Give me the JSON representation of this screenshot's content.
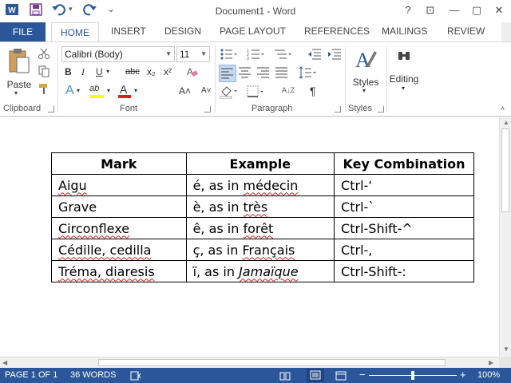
{
  "window": {
    "title": "Document1 - Word",
    "help_glyph": "?",
    "ribbon_display_glyph": "⊡",
    "minimize_glyph": "—",
    "restore_glyph": "▢",
    "close_glyph": "✕"
  },
  "quick_access": {
    "app_icon": "word-icon",
    "save_icon": "save-icon",
    "undo_icon": "undo-icon",
    "redo_icon": "redo-icon",
    "customize_glyph": "⌄"
  },
  "tabs": {
    "file": "FILE",
    "items": [
      "HOME",
      "INSERT",
      "DESIGN",
      "PAGE LAYOUT",
      "REFERENCES",
      "MAILINGS",
      "REVIEW"
    ]
  },
  "ribbon": {
    "groups": {
      "clipboard": "Clipboard",
      "font": "Font",
      "paragraph": "Paragraph",
      "styles": "Styles"
    },
    "paste_label": "Paste",
    "font_name": "Calibri (Body)",
    "font_size": "11",
    "styles_label": "Styles",
    "editing_label": "Editing",
    "font_buttons": {
      "bold": "B",
      "italic": "I",
      "underline": "U",
      "strikethrough": "abc",
      "subscript": "x₂",
      "superscript": "x²",
      "text_effects": "A",
      "highlight": "ab",
      "font_color": "A",
      "grow": "A˄",
      "shrink": "A˅",
      "change_case": "Aa"
    },
    "paragraph_buttons": {
      "show_marks": "¶",
      "sort": "A↓Z"
    }
  },
  "document": {
    "table": {
      "headers": [
        "Mark",
        "Example",
        "Key Combination"
      ],
      "rows": [
        {
          "mark": "Aigu",
          "example_char": "é, as in ",
          "example_word": "médecin",
          "keys": "Ctrl-‘"
        },
        {
          "mark": "Grave",
          "example_char": "è, as in ",
          "example_word": "très",
          "keys": "Ctrl-`"
        },
        {
          "mark": "Circonflexe",
          "example_char": "ê, as in ",
          "example_word": "forêt",
          "keys": "Ctrl-Shift-^"
        },
        {
          "mark": "Cédille, cedilla",
          "example_char": "ç, as in ",
          "example_word": "Français",
          "keys": "Ctrl-,"
        },
        {
          "mark": "Tréma, diaresis",
          "example_char": "ï, as in ",
          "example_word": "Jamaïque",
          "keys": "Ctrl-Shift-:"
        }
      ]
    }
  },
  "status": {
    "page": "PAGE 1 OF 1",
    "words": "36 WORDS",
    "proofing_icon": "proofing-icon",
    "zoom": "100%",
    "zoom_out": "−",
    "zoom_in": "+"
  },
  "colors": {
    "accent": "#2b579a",
    "highlight_yellow": "#ffff00",
    "font_color_red": "#e02020"
  }
}
